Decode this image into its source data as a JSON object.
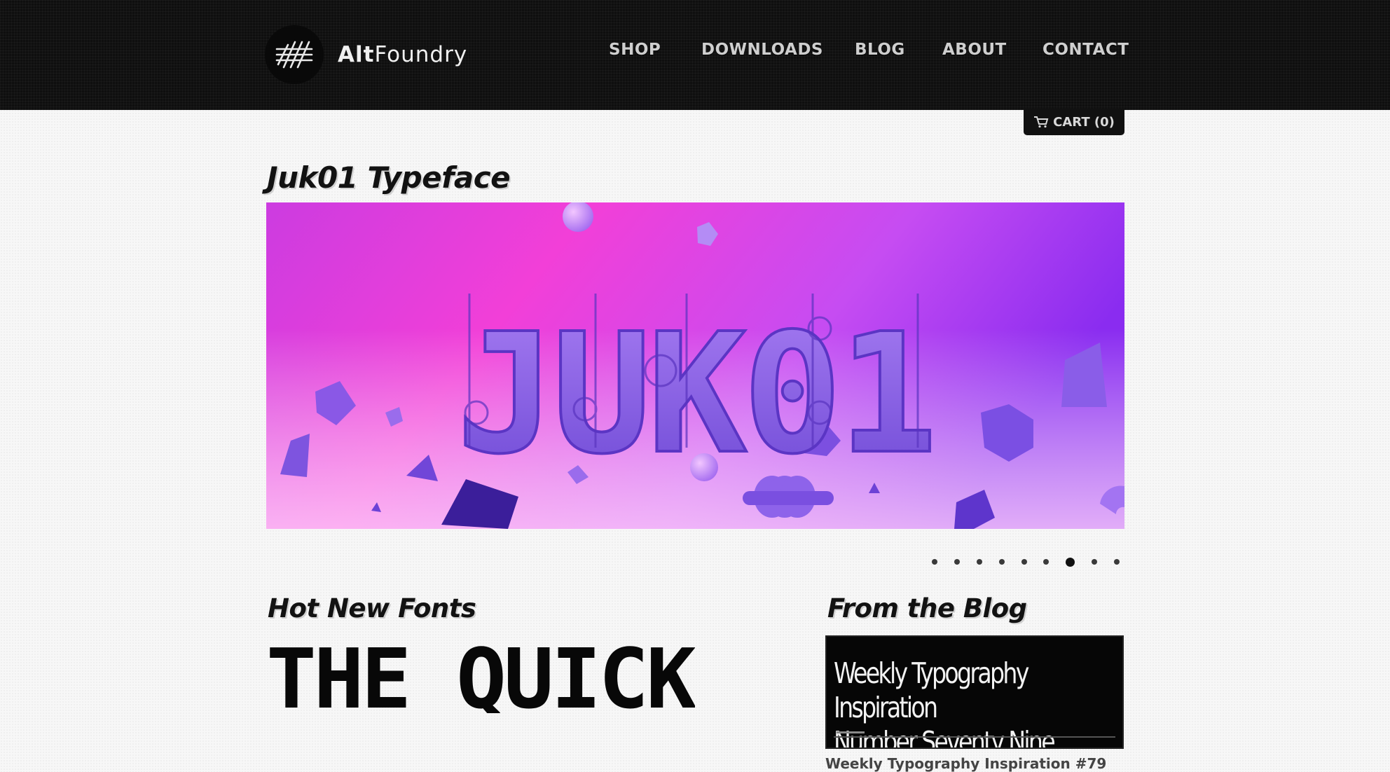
{
  "brand": {
    "name_bold": "Alt",
    "name_regular": "Foundry"
  },
  "nav": {
    "shop": "SHOP",
    "downloads": "DOWNLOADS",
    "blog": "BLOG",
    "about": "ABOUT",
    "contact": "CONTACT"
  },
  "cart": {
    "label": "CART (0)"
  },
  "featured": {
    "title": "Juk01 Typeface",
    "banner_text": "JUK01",
    "slider": {
      "total_slides": 9,
      "active_slide": 7
    }
  },
  "hot_new_fonts": {
    "heading": "Hot New Fonts",
    "specimen_text": "THE QUICK"
  },
  "blog": {
    "heading": "From the Blog",
    "thumb_title": "Weekly Typography Inspiration\nNumber Seventy Nine",
    "post_title": "Weekly Typography Inspiration #79"
  },
  "colors": {
    "header_bg": "#0f0f0f",
    "hero_pink": "#f23fe0",
    "hero_violet": "#8a2cf0"
  }
}
